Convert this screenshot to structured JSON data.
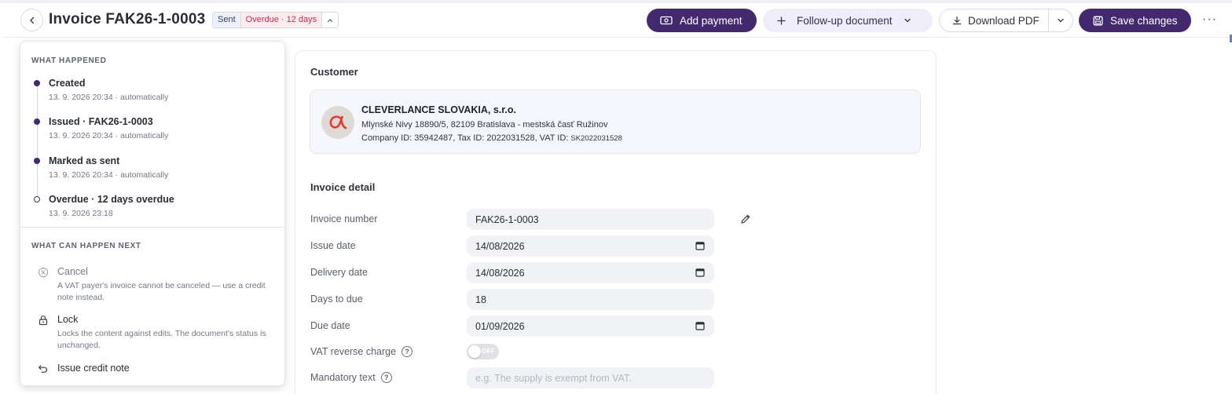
{
  "header": {
    "title": "Invoice FAK26-1-0003",
    "status_sent": "Sent",
    "status_overdue": "Overdue · 12 days",
    "add_payment": "Add payment",
    "follow_up": "Follow-up document",
    "download_pdf": "Download PDF",
    "save_changes": "Save changes",
    "more": "···"
  },
  "history": {
    "heading": "WHAT HAPPENED",
    "items": [
      {
        "title": "Created",
        "sub": "13. 9. 2026 20:34 · automatically"
      },
      {
        "title": "Issued · FAK26-1-0003",
        "sub": "13. 9. 2026 20:34 · automatically"
      },
      {
        "title": "Marked as sent",
        "sub": "13. 9. 2026 20:34 · automatically"
      },
      {
        "title": "Overdue · 12 days overdue",
        "sub": "13. 9. 2026 23:18"
      }
    ]
  },
  "next": {
    "heading": "WHAT CAN HAPPEN NEXT",
    "items": [
      {
        "title": "Cancel",
        "desc": "A VAT payer's invoice cannot be canceled — use a credit note instead."
      },
      {
        "title": "Lock",
        "desc": "Locks the content against edits. The document's status is unchanged."
      },
      {
        "title": "Issue credit note",
        "desc": ""
      }
    ]
  },
  "customer": {
    "label": "Customer",
    "name": "CLEVERLANCE SLOVAKIA, s.r.o.",
    "address": "Mlynské Nivy 18890/5, 82109 Bratislava - mestská časť Ružinov",
    "ids_prefix": "Company ID: 35942487, Tax ID: 2022031528, VAT ID:",
    "vat_id": "SK2022031528",
    "logo_color": "#e5382f"
  },
  "detail": {
    "label": "Invoice detail",
    "invoice_number_label": "Invoice number",
    "invoice_number": "FAK26-1-0003",
    "issue_date_label": "Issue date",
    "issue_date": "14/08/2026",
    "delivery_date_label": "Delivery date",
    "delivery_date": "14/08/2026",
    "days_to_due_label": "Days to due",
    "days_to_due": "18",
    "due_date_label": "Due date",
    "due_date": "01/09/2026",
    "reverse_charge_label": "VAT reverse charge",
    "reverse_charge_state": "OFF",
    "mandatory_text_label": "Mandatory text",
    "mandatory_text_placeholder": "e.g. The supply is exempt from VAT."
  }
}
